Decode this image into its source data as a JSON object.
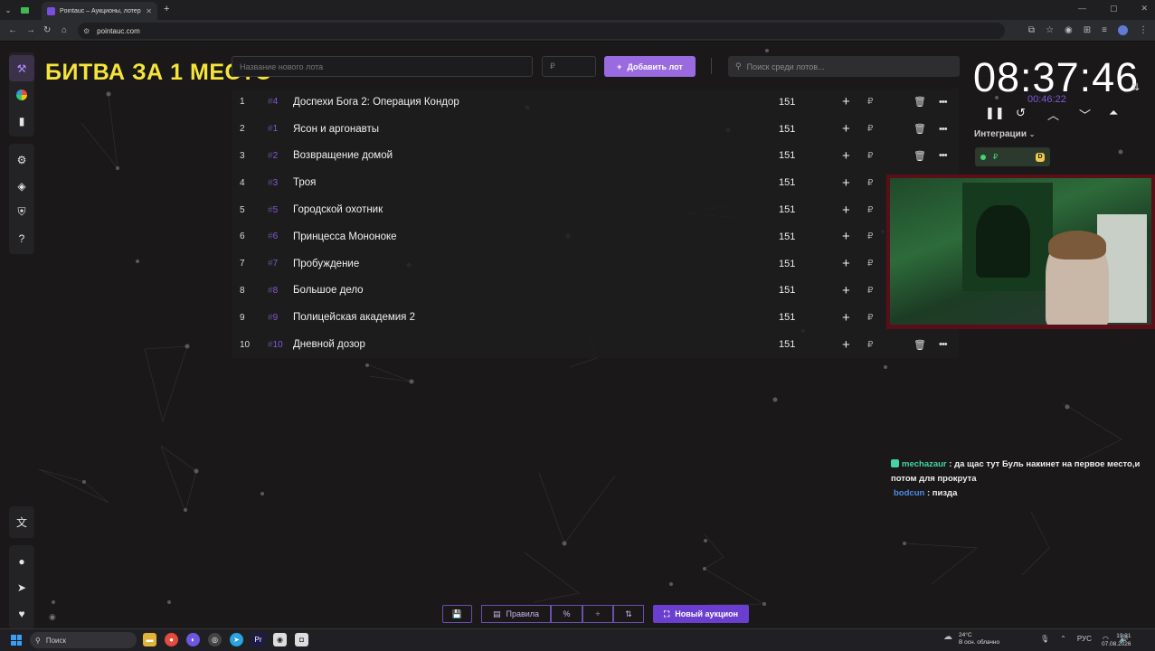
{
  "browser": {
    "tab_title": "Pointauc – Аукционы, лотереи…",
    "url": "pointauc.com"
  },
  "overlay": {
    "title": "БИТВА ЗА 1 МЕСТО"
  },
  "sidebar": {
    "top_group": [
      "gavel-icon",
      "pie-chart-icon",
      "bar-chart-icon"
    ],
    "mid_group": [
      "gear-icon",
      "layers-icon",
      "shield-icon",
      "help-icon"
    ],
    "bottom_group": [
      "translate-icon",
      "github-icon",
      "telegram-icon",
      "donate-icon"
    ]
  },
  "controls": {
    "lot_placeholder": "Название нового лота",
    "price_placeholder": "₽",
    "add_label": "Добавить лот",
    "search_placeholder": "Поиск среди лотов..."
  },
  "lots": [
    {
      "num": "1",
      "id": "4",
      "name": "Доспехи Бога 2: Операция Кондор",
      "amount": "151"
    },
    {
      "num": "2",
      "id": "1",
      "name": "Ясон и аргонавты",
      "amount": "151"
    },
    {
      "num": "3",
      "id": "2",
      "name": "Возвращение домой",
      "amount": "151"
    },
    {
      "num": "4",
      "id": "3",
      "name": "Троя",
      "amount": "151"
    },
    {
      "num": "5",
      "id": "5",
      "name": "Городской охотник",
      "amount": "151"
    },
    {
      "num": "6",
      "id": "6",
      "name": "Принцесса Мононоке",
      "amount": "151"
    },
    {
      "num": "7",
      "id": "7",
      "name": "Пробуждение",
      "amount": "151"
    },
    {
      "num": "8",
      "id": "8",
      "name": "Большое дело",
      "amount": "151"
    },
    {
      "num": "9",
      "id": "9",
      "name": "Полицейская академия 2",
      "amount": "151"
    },
    {
      "num": "10",
      "id": "10",
      "name": "Дневной дозор",
      "amount": "151"
    }
  ],
  "timer": {
    "main": "08:37:46",
    "sub": "00:46:22",
    "integrations_label": "Интеграции"
  },
  "chat": [
    {
      "user": "mechazaur",
      "text": ": да щас тут Буль накинет на первое место,и потом для прокрута"
    },
    {
      "user": "bodcun",
      "text": ": пизда"
    }
  ],
  "bottom_toolbar": {
    "rules_label": "Правила",
    "new_auction_label": "Новый аукцион"
  },
  "taskbar": {
    "search_label": "Поиск",
    "weather_temp": "24°C",
    "weather_desc": "В осн. облачно",
    "lang": "РУС",
    "time": "19:31",
    "date": "07.08.2026"
  },
  "colors": {
    "accent": "#9a6be0",
    "title_yellow": "#f4e43b",
    "timer_sub": "#7d5ad6",
    "chat_user1": "#42d6a0",
    "chat_user2": "#4d8ee6"
  }
}
